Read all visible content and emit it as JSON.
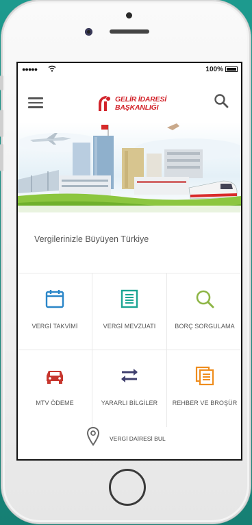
{
  "status_bar": {
    "signal": "●●●●●",
    "battery": "100%"
  },
  "header": {
    "logo_line1": "GELİR İDARESİ",
    "logo_line2": "BAŞKANLIĞI"
  },
  "tagline": "Vergilerinizle Büyüyen Türkiye",
  "menu": [
    {
      "label": "VERGİ TAKVİMİ",
      "icon": "calendar-icon",
      "color": "#2a86c8"
    },
    {
      "label": "VERGİ MEVZUATI",
      "icon": "document-list-icon",
      "color": "#1aa593"
    },
    {
      "label": "BORÇ SORGULAMA",
      "icon": "magnifier-icon",
      "color": "#8db545"
    },
    {
      "label": "MTV ÖDEME",
      "icon": "car-icon",
      "color": "#c7362e"
    },
    {
      "label": "YARARLI BİLGİLER",
      "icon": "transfer-arrows-icon",
      "color": "#3f3f6e"
    },
    {
      "label": "REHBER VE BROŞÜR",
      "icon": "documents-stack-icon",
      "color": "#ef8d1e"
    }
  ],
  "finder": {
    "label": "VERGİ DAİRESİ BUL",
    "icon": "location-pin-icon"
  },
  "colors": {
    "brand": "#d2232a",
    "background": "#1d9a8e"
  }
}
